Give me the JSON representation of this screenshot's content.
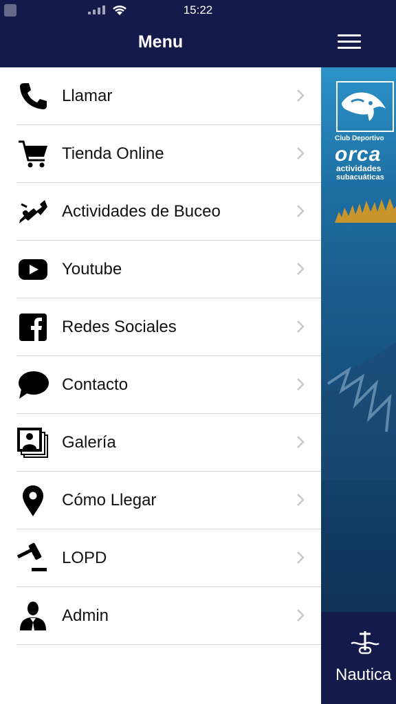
{
  "status_bar": {
    "time": "15:22"
  },
  "drawer": {
    "title": "Menu",
    "items": [
      {
        "label": "Llamar",
        "icon": "phone-icon"
      },
      {
        "label": "Tienda Online",
        "icon": "cart-icon"
      },
      {
        "label": "Actividades de Buceo",
        "icon": "diver-icon"
      },
      {
        "label": "Youtube",
        "icon": "youtube-icon"
      },
      {
        "label": "Redes Sociales",
        "icon": "facebook-icon"
      },
      {
        "label": "Contacto",
        "icon": "chat-bubble-icon"
      },
      {
        "label": "Galería",
        "icon": "gallery-icon"
      },
      {
        "label": "Cómo Llegar",
        "icon": "location-pin-icon"
      },
      {
        "label": "LOPD",
        "icon": "gavel-icon"
      },
      {
        "label": "Admin",
        "icon": "admin-user-icon"
      }
    ]
  },
  "banner": {
    "club": "Club Deportivo",
    "brand": "orca",
    "subtitle_line1": "actividades",
    "subtitle_line2": "subacuáticas"
  },
  "tabbar": {
    "label": "Nautica",
    "icon": "nautica-icon"
  },
  "colors": {
    "header_bg": "#141a4a",
    "menu_bg": "#ffffff",
    "divider": "#d4d4d4",
    "chevron": "#c7c7cc"
  }
}
